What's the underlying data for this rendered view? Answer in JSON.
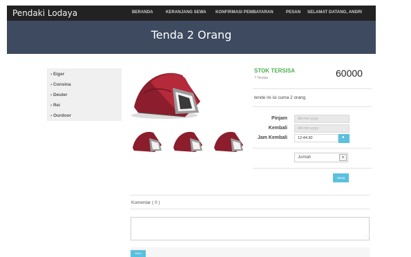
{
  "navbar": {
    "brand": "Pendaki Lodaya",
    "links": [
      "BERANDA",
      "KERANJANG SEWA",
      "KONFIRMASI PEMBAYARAN",
      "PESAN",
      "SELAMAT DATANG, ANDRI"
    ]
  },
  "hero": {
    "title": "Tenda 2 Orang"
  },
  "sidebar": {
    "categories": [
      "› Eiger",
      "› Consina",
      "› Deuter",
      "› Rei",
      "› Ourdoor"
    ]
  },
  "product": {
    "stock_label": "STOK TERSISA",
    "stock_sub": "7 Tersisa",
    "price": "60000",
    "description": "tende ini isi cuma 2 orang"
  },
  "form": {
    "pinjam_label": "Pinjam",
    "pinjam_placeholder": "dd-mm-yyyy",
    "kembali_label": "Kembali",
    "kembali_placeholder": "dd-mm-yyyy",
    "jam_kembali_label": "Jam Kembali",
    "jam_kembali_value": "12:44:30",
    "jumlah_selected": "Jumlah",
    "sewa_label": "Sewa"
  },
  "comments": {
    "tab_label": "Komentar ( 0 )",
    "submit_label": "Kirim"
  },
  "colors": {
    "navbar": "#222222",
    "hero": "#3d4a60",
    "accent": "#5bc0de",
    "stock": "#4caf50",
    "tent_red": "#8b1d2c",
    "tent_grey": "#9a9a9a"
  }
}
